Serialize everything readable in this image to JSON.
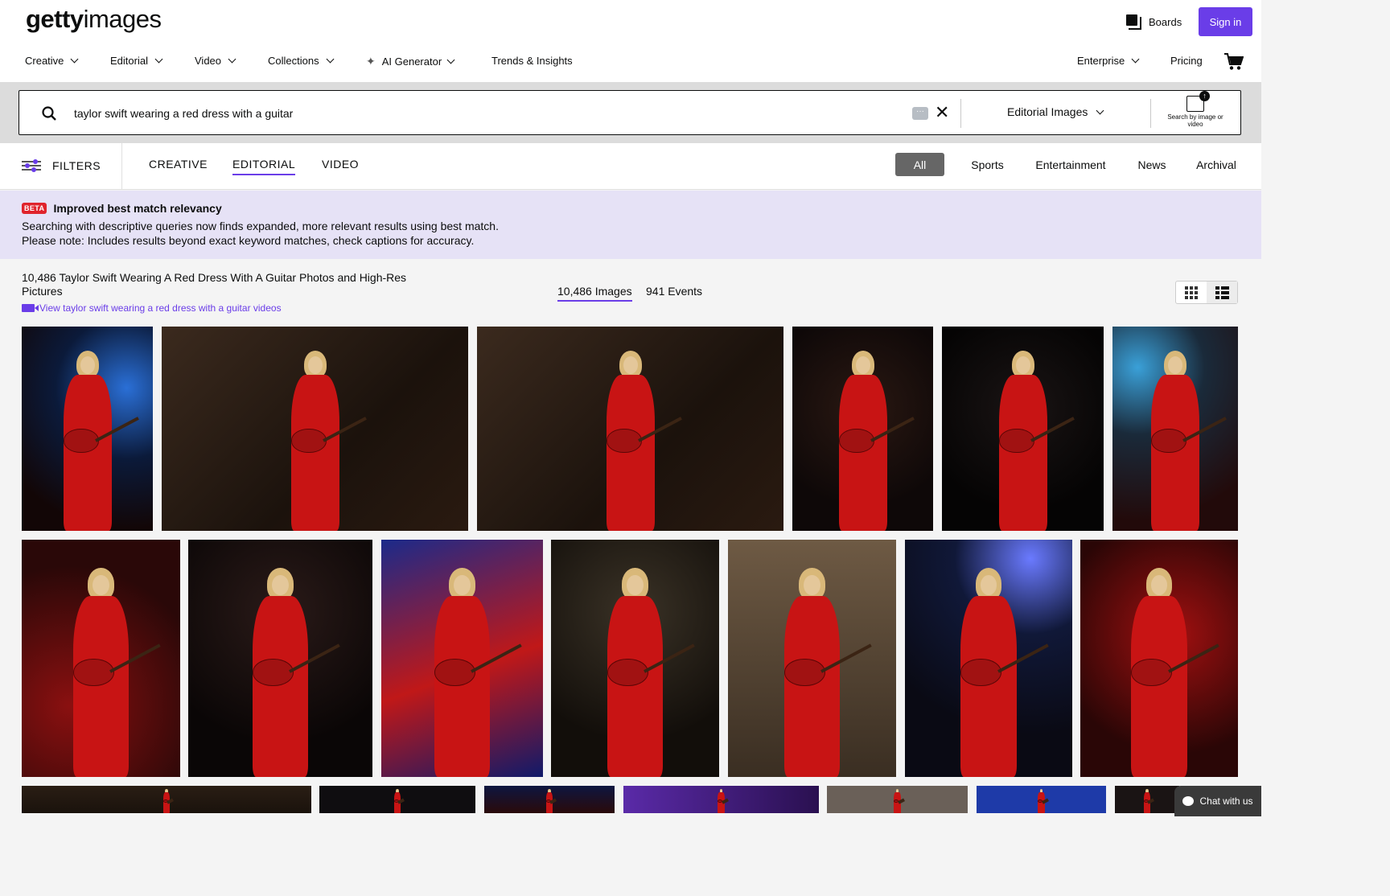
{
  "header": {
    "logo_bold": "getty",
    "logo_light": "images",
    "boards_label": "Boards",
    "signin_label": "Sign in",
    "nav": [
      {
        "label": "Creative"
      },
      {
        "label": "Editorial"
      },
      {
        "label": "Video"
      },
      {
        "label": "Collections"
      },
      {
        "label": "AI Generator"
      },
      {
        "label": "Trends & Insights"
      }
    ],
    "nav_right": [
      {
        "label": "Enterprise"
      },
      {
        "label": "Pricing"
      }
    ]
  },
  "search": {
    "query": "taylor swift wearing a red dress with a guitar",
    "scope_label": "Editorial Images",
    "search_by_image_label": "Search by image or video"
  },
  "filter_bar": {
    "filters_label": "FILTERS",
    "tabs": [
      "CREATIVE",
      "EDITORIAL",
      "VIDEO"
    ],
    "active_tab": "EDITORIAL",
    "pills": [
      "All",
      "Sports",
      "Entertainment",
      "News",
      "Archival"
    ],
    "active_pill": "All"
  },
  "beta_banner": {
    "badge": "BETA",
    "title": "Improved best match relevancy",
    "line1": "Searching with descriptive queries now finds expanded, more relevant results using best match.",
    "line2": "Please note: Includes results beyond exact keyword matches, check captions for accuracy."
  },
  "results": {
    "title": "10,486 Taylor Swift Wearing A Red Dress With A Guitar Photos and High-Res Pictures",
    "video_link": "View taylor swift wearing a red dress with a guitar videos",
    "count_tabs": [
      "10,486 Images",
      "941 Events"
    ],
    "active_count_tab": "10,486 Images"
  },
  "chat": {
    "label": "Chat with us"
  },
  "colors": {
    "accent": "#6a3de8",
    "beta_red": "#e0242c",
    "banner_bg": "#e6e2f6"
  }
}
